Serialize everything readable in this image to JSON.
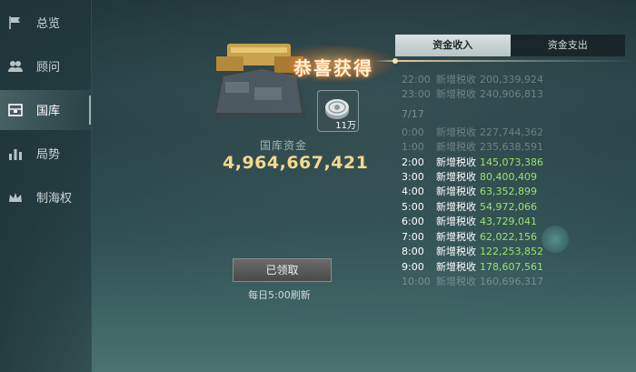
{
  "sidebar": {
    "items": [
      {
        "label": "总览",
        "icon": "flag-icon"
      },
      {
        "label": "顾问",
        "icon": "advisors-icon"
      },
      {
        "label": "国库",
        "icon": "treasury-icon",
        "active": true
      },
      {
        "label": "局势",
        "icon": "bar-chart-icon"
      },
      {
        "label": "制海权",
        "icon": "crown-icon"
      }
    ]
  },
  "reward": {
    "banner": "恭喜获得",
    "item_icon": "silver-coin-icon",
    "item_qty": "11万"
  },
  "treasury": {
    "label": "国库资金",
    "amount": "4,964,667,421",
    "claim_button": "已领取",
    "refresh_note": "每日5:00刷新"
  },
  "tabs": [
    {
      "label": "资金收入",
      "active": true
    },
    {
      "label": "资金支出",
      "active": false
    }
  ],
  "income_log": [
    {
      "time": "22:00",
      "label": "新增税收",
      "value": "200,339,924",
      "faded": true
    },
    {
      "time": "23:00",
      "label": "新增税收",
      "value": "240,906,813",
      "faded": true
    },
    {
      "time": "7/17",
      "label": "",
      "value": "",
      "date": true
    },
    {
      "time": "0:00",
      "label": "新增税收",
      "value": "227,744,362",
      "faded": true
    },
    {
      "time": "1:00",
      "label": "新增税收",
      "value": "235,638,591",
      "faded": true
    },
    {
      "time": "2:00",
      "label": "新增税收",
      "value": "145,073,386"
    },
    {
      "time": "3:00",
      "label": "新增税收",
      "value": "80,400,409"
    },
    {
      "time": "4:00",
      "label": "新增税收",
      "value": "63,352,899"
    },
    {
      "time": "5:00",
      "label": "新增税收",
      "value": "54,972,066"
    },
    {
      "time": "6:00",
      "label": "新增税收",
      "value": "43,729,041"
    },
    {
      "time": "7:00",
      "label": "新增税收",
      "value": "62,022,156"
    },
    {
      "time": "8:00",
      "label": "新增税收",
      "value": "122,253,852"
    },
    {
      "time": "9:00",
      "label": "新增税收",
      "value": "178,607,561"
    },
    {
      "time": "10:00",
      "label": "新增税收",
      "value": "160,696,317",
      "fade_bottom": true
    }
  ],
  "colors": {
    "amount": "#f4d98d",
    "income_value": "#9be36a",
    "banner_glow": "#ff9a3a"
  }
}
